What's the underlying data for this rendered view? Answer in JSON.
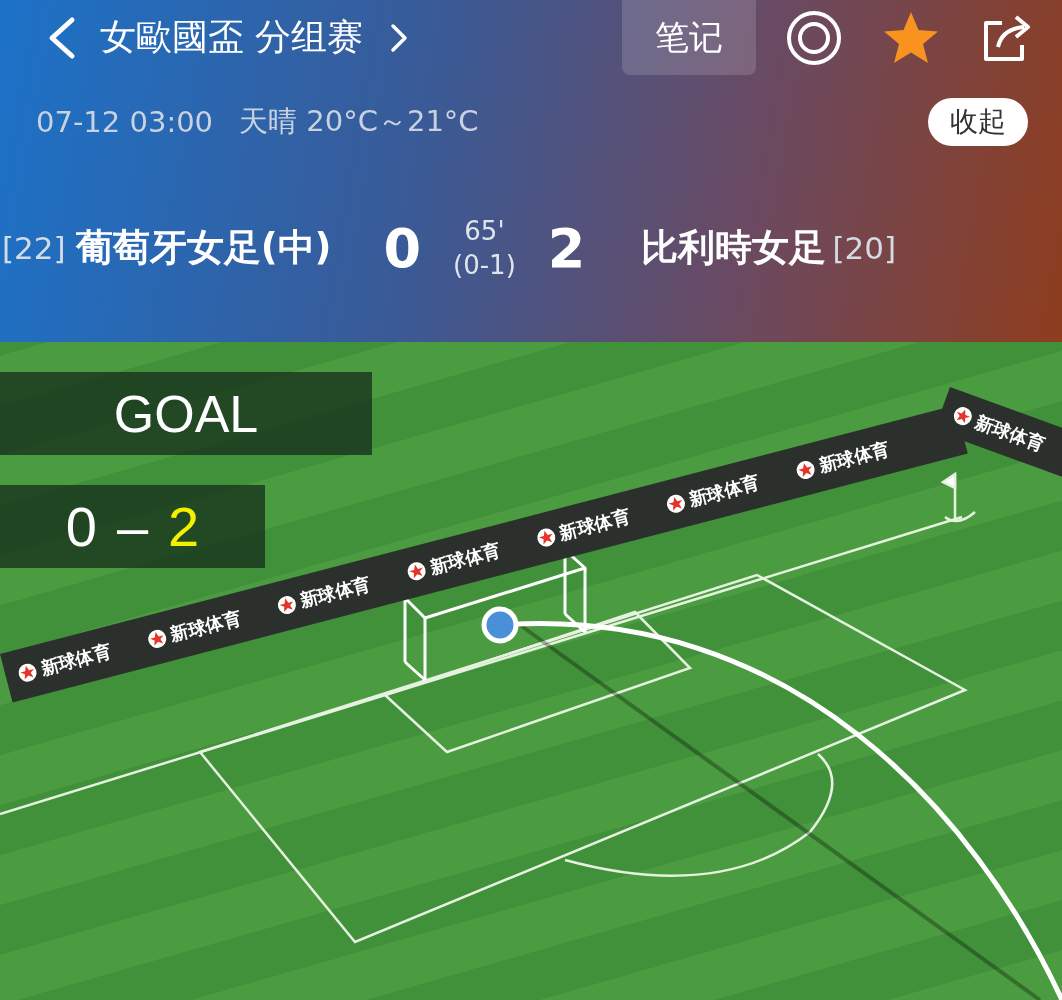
{
  "header": {
    "title": "女歐國盃 分组赛",
    "note_button": "笔记",
    "favorited": true
  },
  "info": {
    "datetime": "07-12 03:00",
    "weather": "天晴 20°C～21°C",
    "collapse_button": "收起"
  },
  "match": {
    "home": {
      "rank": "[22]",
      "name": "葡萄牙女足(中)",
      "score": "0"
    },
    "away": {
      "rank": "[20]",
      "name": "比利時女足",
      "score": "2"
    },
    "minute": "65'",
    "half_time": "(0-1)"
  },
  "pitch": {
    "event": "GOAL",
    "score": {
      "home": {
        "value": "0",
        "highlighted": false
      },
      "separator": "–",
      "away": {
        "value": "2",
        "highlighted": true
      }
    },
    "boards": [
      {
        "kind": "main",
        "texts": [
          "新球体育",
          "新球体育",
          "新球体育",
          "新球体育",
          "新球体育",
          "新球体育",
          "新球体育"
        ]
      },
      {
        "kind": "side",
        "texts": [
          "新球体育"
        ]
      }
    ]
  }
}
